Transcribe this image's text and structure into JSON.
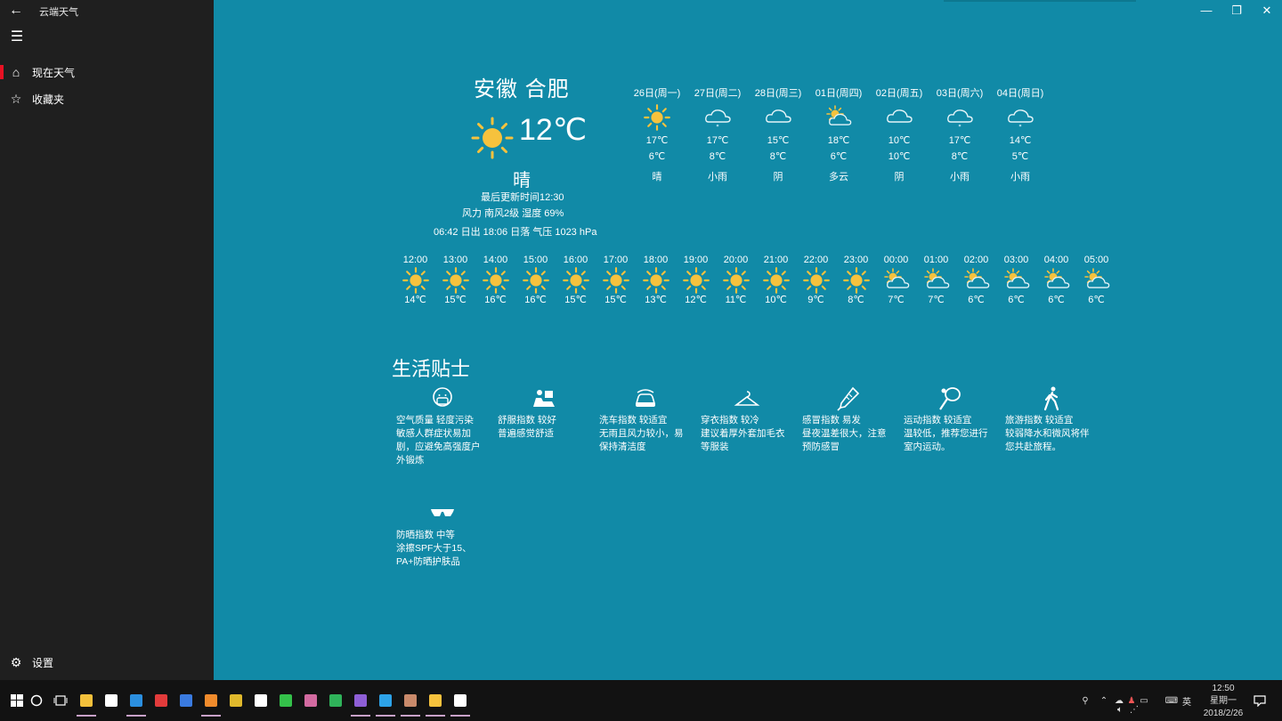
{
  "app": {
    "title": "云端天气",
    "back_icon": "back-arrow-icon"
  },
  "sidebar": {
    "items": [
      {
        "label": "现在天气",
        "icon": "home-icon",
        "active": true
      },
      {
        "label": "收藏夹",
        "icon": "star-icon",
        "active": false
      }
    ],
    "settings_label": "设置"
  },
  "titlebar": {
    "minimize": "—",
    "restore": "❐",
    "close": "✕"
  },
  "current": {
    "city": "安徽  合肥",
    "temp": "12℃",
    "condition": "晴",
    "updated": "最后更新时间12:30",
    "wind": "风力  南风2级     湿度  69%",
    "sun": "06:42 日出      18:06 日落   气压 1023 hPa"
  },
  "daily": [
    {
      "date": "26日(周一)",
      "hi": "17℃",
      "lo": "6℃",
      "cond": "晴",
      "icon": "sun"
    },
    {
      "date": "27日(周二)",
      "hi": "17℃",
      "lo": "8℃",
      "cond": "小雨",
      "icon": "rain"
    },
    {
      "date": "28日(周三)",
      "hi": "15℃",
      "lo": "8℃",
      "cond": "阴",
      "icon": "cloud"
    },
    {
      "date": "01日(周四)",
      "hi": "18℃",
      "lo": "6℃",
      "cond": "多云",
      "icon": "partly"
    },
    {
      "date": "02日(周五)",
      "hi": "10℃",
      "lo": "10℃",
      "cond": "阴",
      "icon": "cloud"
    },
    {
      "date": "03日(周六)",
      "hi": "17℃",
      "lo": "8℃",
      "cond": "小雨",
      "icon": "rain"
    },
    {
      "date": "04日(周日)",
      "hi": "14℃",
      "lo": "5℃",
      "cond": "小雨",
      "icon": "rain"
    }
  ],
  "hourly": [
    {
      "time": "12:00",
      "temp": "14℃",
      "icon": "sun"
    },
    {
      "time": "13:00",
      "temp": "15℃",
      "icon": "sun"
    },
    {
      "time": "14:00",
      "temp": "16℃",
      "icon": "sun"
    },
    {
      "time": "15:00",
      "temp": "16℃",
      "icon": "sun"
    },
    {
      "time": "16:00",
      "temp": "15℃",
      "icon": "sun"
    },
    {
      "time": "17:00",
      "temp": "15℃",
      "icon": "sun"
    },
    {
      "time": "18:00",
      "temp": "13℃",
      "icon": "sun"
    },
    {
      "time": "19:00",
      "temp": "12℃",
      "icon": "sun"
    },
    {
      "time": "20:00",
      "temp": "11℃",
      "icon": "sun"
    },
    {
      "time": "21:00",
      "temp": "10℃",
      "icon": "sun"
    },
    {
      "time": "22:00",
      "temp": "9℃",
      "icon": "sun"
    },
    {
      "time": "23:00",
      "temp": "8℃",
      "icon": "sun"
    },
    {
      "time": "00:00",
      "temp": "7℃",
      "icon": "partly"
    },
    {
      "time": "01:00",
      "temp": "7℃",
      "icon": "partly"
    },
    {
      "time": "02:00",
      "temp": "6℃",
      "icon": "partly"
    },
    {
      "time": "03:00",
      "temp": "6℃",
      "icon": "partly"
    },
    {
      "time": "04:00",
      "temp": "6℃",
      "icon": "partly"
    },
    {
      "time": "05:00",
      "temp": "6℃",
      "icon": "partly"
    }
  ],
  "tips": {
    "title": "生活贴士",
    "items": [
      {
        "icon": "mask-icon",
        "text": "空气质量   轻度污染\n敏感人群症状易加剧，应避免高强度户外锻炼"
      },
      {
        "icon": "sofa-icon",
        "text": "舒服指数   较好\n普遍感觉舒适"
      },
      {
        "icon": "car-icon",
        "text": "洗车指数   较适宜\n无雨且风力较小，易保持清洁度"
      },
      {
        "icon": "hanger-icon",
        "text": "穿衣指数   较冷\n建议着厚外套加毛衣等服装"
      },
      {
        "icon": "thermometer-icon",
        "text": "感冒指数   易发\n昼夜温差很大，注意预防感冒"
      },
      {
        "icon": "racket-icon",
        "text": "运动指数   较适宜\n温较低，推荐您进行室内运动。"
      },
      {
        "icon": "walker-icon",
        "text": "旅游指数   较适宜\n较弱降水和微风将伴您共赴旅程。"
      },
      {
        "icon": "sunglasses-icon",
        "text": "防晒指数   中等\n涂擦SPF大于15、PA+防晒护肤品"
      }
    ]
  },
  "taskbar": {
    "apps": [
      {
        "name": "file-explorer-icon",
        "color": "#f3c03b",
        "open": true
      },
      {
        "name": "store-icon",
        "color": "#ffffff",
        "open": false
      },
      {
        "name": "edge-icon",
        "color": "#2b8fe0",
        "open": true
      },
      {
        "name": "red-app-icon",
        "color": "#e23b3b",
        "open": false
      },
      {
        "name": "blue-app-icon",
        "color": "#3a7be0",
        "open": false
      },
      {
        "name": "orange-app-icon",
        "color": "#f08b2c",
        "open": true
      },
      {
        "name": "chrome-icon",
        "color": "#e0b92c",
        "open": false
      },
      {
        "name": "mail-icon",
        "color": "#ffffff",
        "open": false
      },
      {
        "name": "green-app-icon",
        "color": "#34c14a",
        "open": false
      },
      {
        "name": "cloud-app-icon",
        "color": "#d26aa0",
        "open": false
      },
      {
        "name": "green-c-icon",
        "color": "#2fb35a",
        "open": false
      },
      {
        "name": "visual-studio-icon",
        "color": "#8e5fd6",
        "open": true
      },
      {
        "name": "photoshop-icon",
        "color": "#2da3e8",
        "open": true
      },
      {
        "name": "avatar-app-icon",
        "color": "#c98a6b",
        "open": true
      },
      {
        "name": "weather-app-icon",
        "color": "#f6c23d",
        "open": true
      },
      {
        "name": "settings-app-icon",
        "color": "#ffffff",
        "open": true
      }
    ],
    "tray_lang": "英",
    "clock_time": "12:50",
    "clock_day": "星期一",
    "clock_date": "2018/2/26"
  },
  "colors": {
    "background": "#118aa7",
    "sidebar": "#1f1f1f",
    "sun": "#f6c23d",
    "accent": "#e81123"
  }
}
